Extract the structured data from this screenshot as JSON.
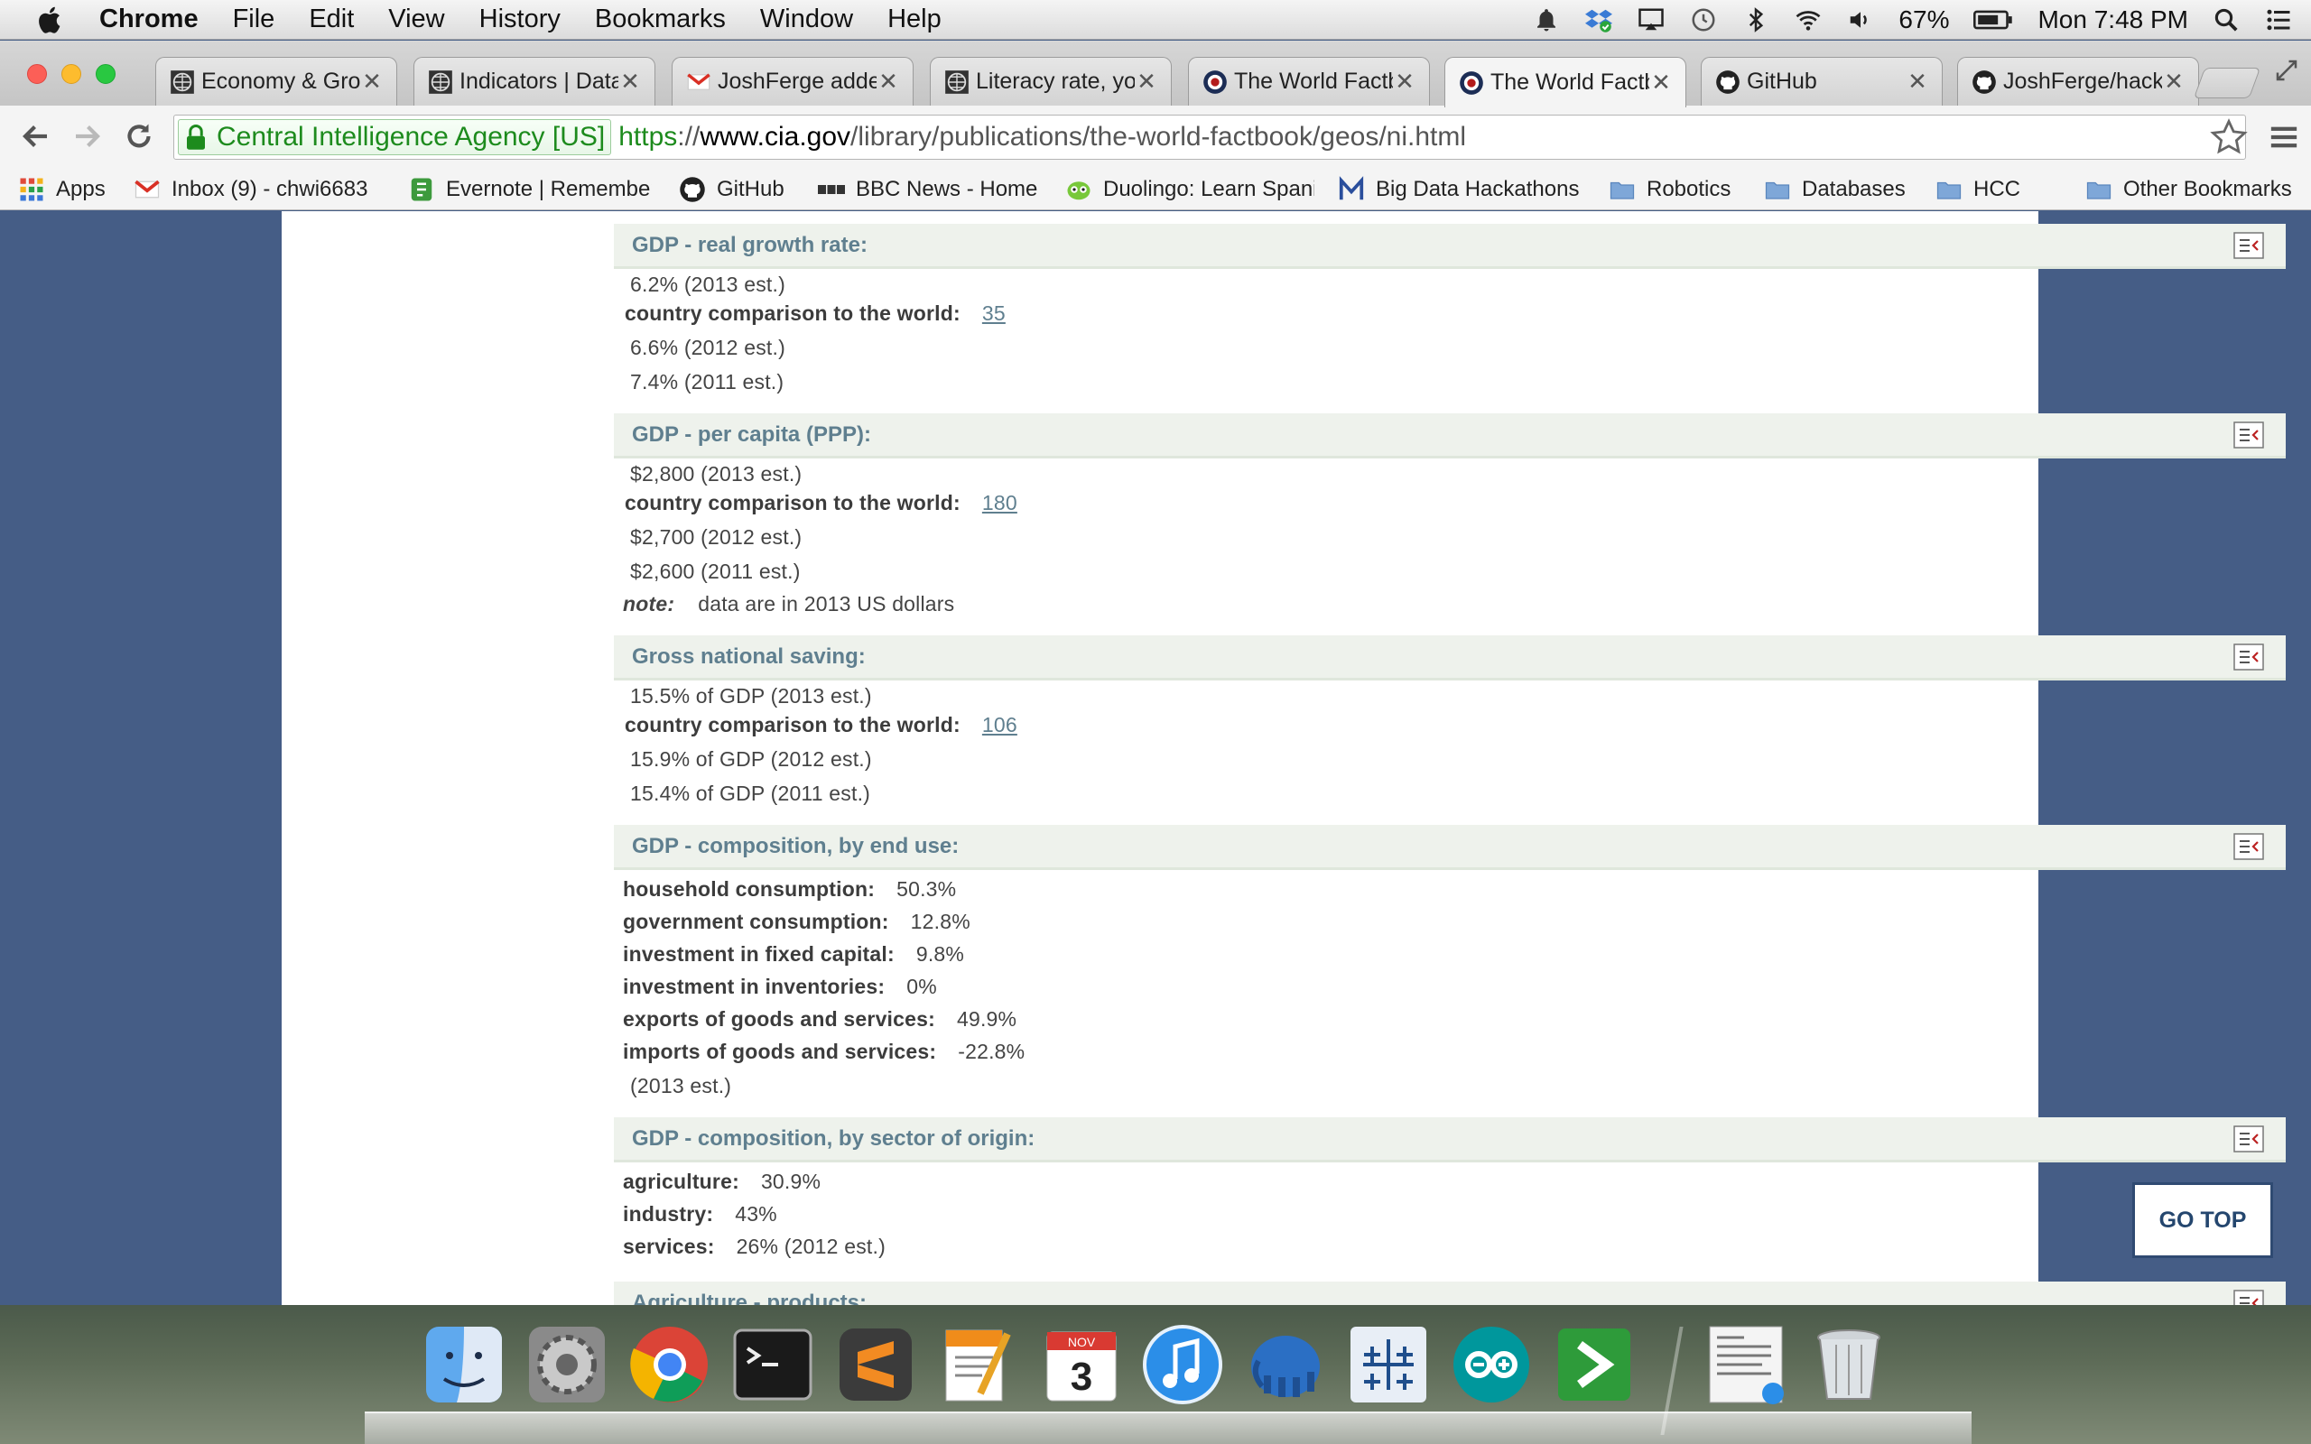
{
  "menubar": {
    "app_name": "Chrome",
    "items": [
      "File",
      "Edit",
      "View",
      "History",
      "Bookmarks",
      "Window",
      "Help"
    ],
    "battery": "67%",
    "clock": "Mon 7:48 PM"
  },
  "tabs": [
    {
      "title": "Economy & Grow",
      "icon": "globe-icon",
      "active": false
    },
    {
      "title": "Indicators | Data",
      "icon": "globe-icon",
      "active": false
    },
    {
      "title": "JoshFerge added",
      "icon": "gmail-icon",
      "active": false
    },
    {
      "title": "Literacy rate, you",
      "icon": "globe-icon",
      "active": false
    },
    {
      "title": "The World Factbo",
      "icon": "cia-seal-icon",
      "active": false
    },
    {
      "title": "The World Factbo",
      "icon": "cia-seal-icon",
      "active": true
    },
    {
      "title": "GitHub",
      "icon": "github-icon",
      "active": false
    },
    {
      "title": "JoshFerge/hacka",
      "icon": "github-icon",
      "active": false
    }
  ],
  "omnibox": {
    "ev_name": "Central Intelligence Agency [US]",
    "url_scheme": "https",
    "url_sep": "://",
    "url_host": "www.cia.gov",
    "url_path": "/library/publications/the-world-factbook/geos/ni.html"
  },
  "bookmarks": [
    {
      "label": "Apps",
      "icon": "apps-grid-icon"
    },
    {
      "label": "Inbox (9) - chwi6683",
      "icon": "gmail-icon"
    },
    {
      "label": "Evernote | Remember",
      "icon": "evernote-icon"
    },
    {
      "label": "GitHub",
      "icon": "github-icon"
    },
    {
      "label": "BBC News - Home",
      "icon": "bbc-icon"
    },
    {
      "label": "Duolingo: Learn Spani",
      "icon": "duolingo-icon"
    },
    {
      "label": "Big Data Hackathons",
      "icon": "m-logo-icon"
    },
    {
      "label": "Robotics",
      "icon": "folder-icon"
    },
    {
      "label": "Databases",
      "icon": "folder-icon"
    },
    {
      "label": "HCC",
      "icon": "folder-icon"
    },
    {
      "label": "Other Bookmarks",
      "icon": "folder-icon"
    }
  ],
  "factbook": {
    "gdp_growth": {
      "title": "GDP - real growth rate:",
      "v2013": "6.2% (2013 est.)",
      "rank_label": "country comparison to the world:",
      "rank": "35",
      "v2012": "6.6% (2012 est.)",
      "v2011": "7.4% (2011 est.)"
    },
    "gdp_per_capita": {
      "title": "GDP - per capita (PPP):",
      "v2013": "$2,800 (2013 est.)",
      "rank_label": "country comparison to the world:",
      "rank": "180",
      "v2012": "$2,700 (2012 est.)",
      "v2011": "$2,600 (2011 est.)",
      "note_label": "note:",
      "note": "data are in 2013 US dollars"
    },
    "national_saving": {
      "title": "Gross national saving:",
      "v2013": "15.5% of GDP (2013 est.)",
      "rank_label": "country comparison to the world:",
      "rank": "106",
      "v2012": "15.9% of GDP (2012 est.)",
      "v2011": "15.4% of GDP (2011 est.)"
    },
    "end_use": {
      "title": "GDP - composition, by end use:",
      "items": [
        {
          "label": "household consumption:",
          "value": "50.3%"
        },
        {
          "label": "government consumption:",
          "value": "12.8%"
        },
        {
          "label": "investment in fixed capital:",
          "value": "9.8%"
        },
        {
          "label": "investment in inventories:",
          "value": "0%"
        },
        {
          "label": "exports of goods and services:",
          "value": "49.9%"
        },
        {
          "label": "imports of goods and services:",
          "value": "-22.8%"
        }
      ],
      "est": "(2013 est.)"
    },
    "sector": {
      "title": "GDP - composition, by sector of origin:",
      "items": [
        {
          "label": "agriculture:",
          "value": "30.9%"
        },
        {
          "label": "industry:",
          "value": "43%"
        },
        {
          "label": "services:",
          "value": "26% (2012 est.)"
        }
      ]
    },
    "agri": {
      "title": "Agriculture - products:"
    }
  },
  "go_top": "GO TOP",
  "dock": [
    "finder-icon",
    "system-preferences-icon",
    "chrome-icon",
    "terminal-icon",
    "sublime-text-icon",
    "pages-icon",
    "calendar-icon",
    "itunes-icon",
    "postgres-elephant-icon",
    "tableau-icon",
    "arduino-icon",
    "prompt-icon",
    "downloads-stack-icon",
    "trash-icon"
  ],
  "calendar": {
    "month": "NOV",
    "day": "3"
  },
  "colors": {
    "section_title": "#5f7f8f",
    "page_bg": "#455d86",
    "go_top_border": "#2f4a72"
  }
}
